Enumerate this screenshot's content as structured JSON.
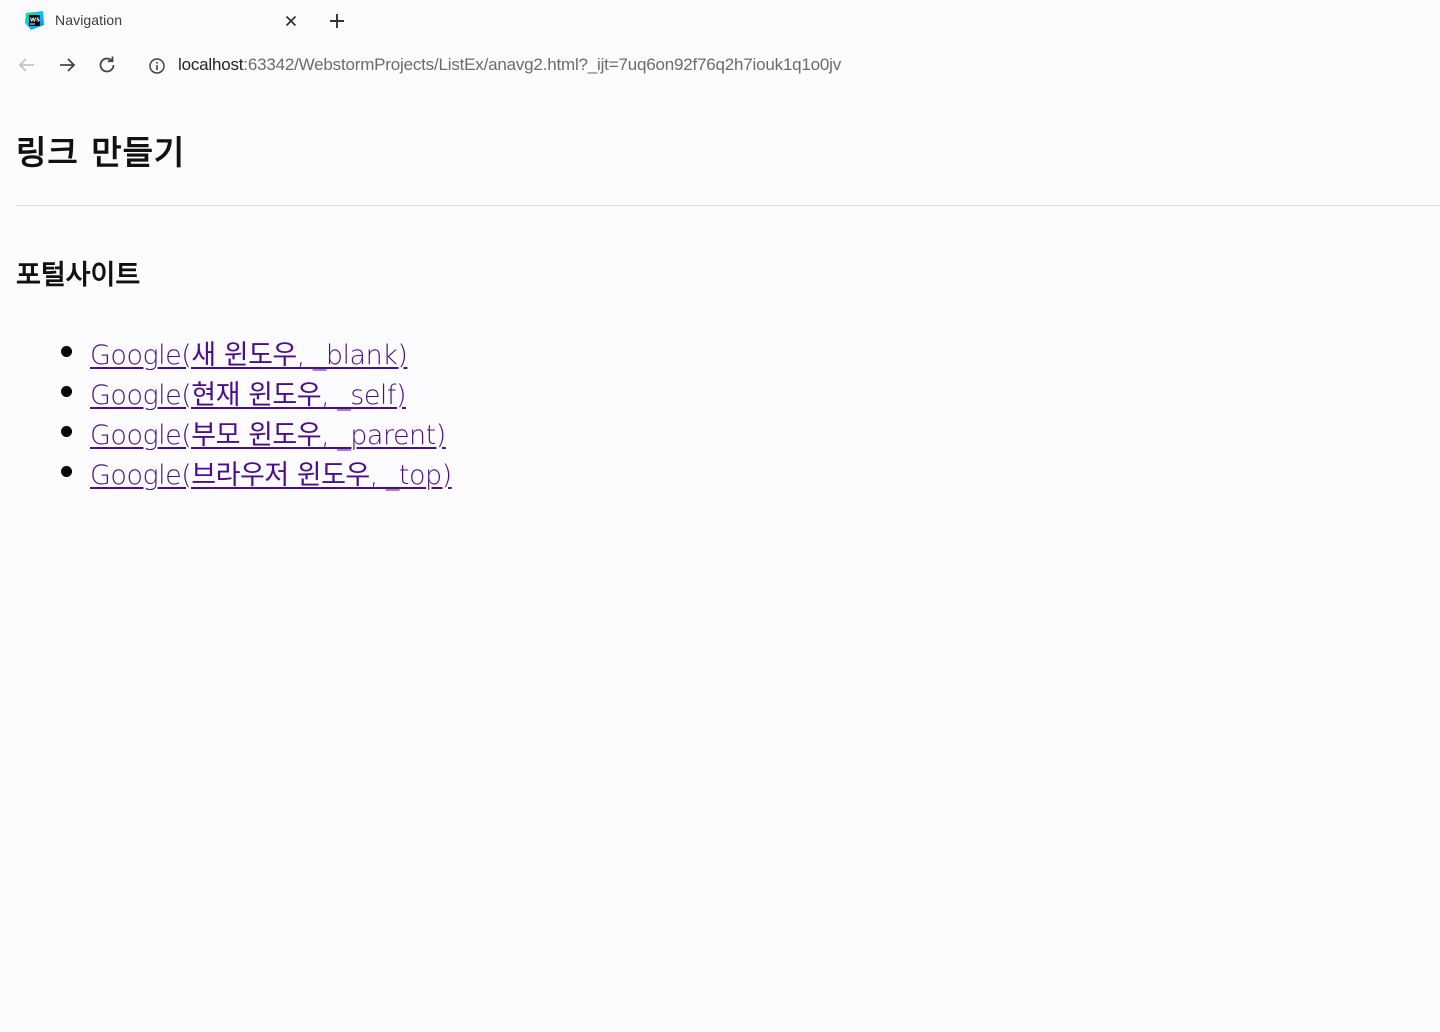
{
  "browser": {
    "tab": {
      "title": "Navigation",
      "favicon": "webstorm-icon"
    },
    "address": {
      "host": "localhost",
      "rest": ":63342/WebstormProjects/ListEx/anavg2.html?_ijt=7uq6on92f76q2h7iouk1q1o0jv"
    }
  },
  "page": {
    "heading": "링크 만들기",
    "subheading": "포털사이트",
    "links": [
      {
        "label": "Google(새 윈도우, _blank)"
      },
      {
        "label": "Google(현재 윈도우, _self)"
      },
      {
        "label": "Google(부모 윈도우, _parent)"
      },
      {
        "label": "Google(브라우저 윈도우, _top)"
      }
    ],
    "link_color": "#4b0d8e"
  }
}
